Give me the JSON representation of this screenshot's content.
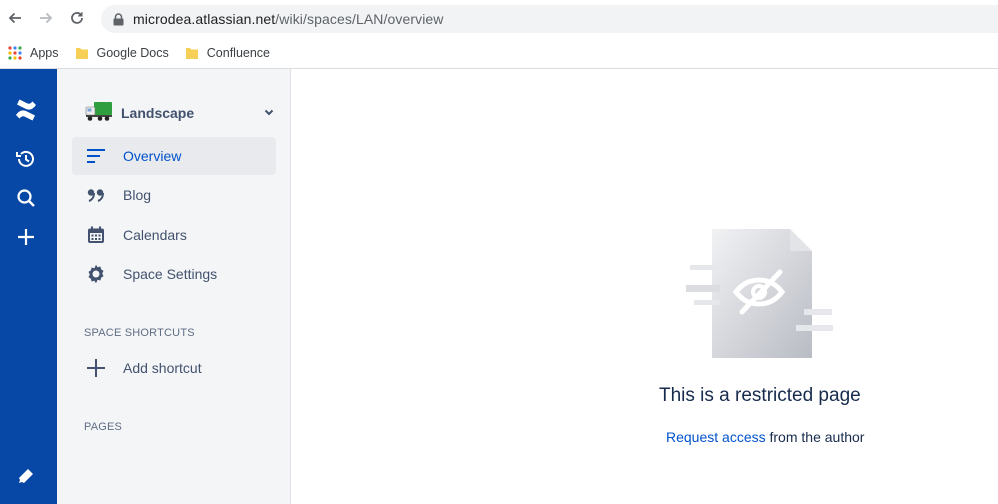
{
  "browser": {
    "url_host": "microdea.atlassian.net",
    "url_path": "/wiki/spaces/LAN/overview",
    "bookmarks": [
      {
        "label": "Apps",
        "icon": "apps-grid-icon"
      },
      {
        "label": "Google Docs",
        "icon": "folder-icon"
      },
      {
        "label": "Confluence",
        "icon": "folder-icon"
      }
    ]
  },
  "space": {
    "name": "Landscape"
  },
  "sidebar": {
    "items": [
      {
        "label": "Overview",
        "icon": "overview-icon",
        "active": true
      },
      {
        "label": "Blog",
        "icon": "quote-icon"
      },
      {
        "label": "Calendars",
        "icon": "calendar-icon"
      },
      {
        "label": "Space Settings",
        "icon": "gear-icon"
      }
    ],
    "shortcuts_heading": "SPACE SHORTCUTS",
    "add_shortcut_label": "Add shortcut",
    "pages_heading": "PAGES"
  },
  "main": {
    "title": "This is a restricted page",
    "request_link": "Request access",
    "message_suffix": " from the author"
  },
  "colors": {
    "global_nav": "#0747a6",
    "link": "#0052cc",
    "sidebar_bg": "#f4f5f7"
  }
}
